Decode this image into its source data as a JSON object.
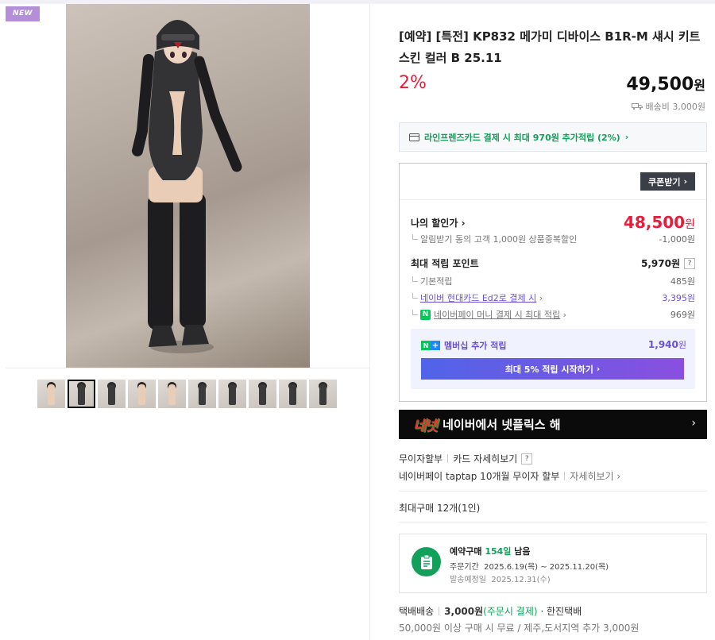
{
  "badge": "NEW",
  "product": {
    "title": "[예약] [특전] KP832 메가미 디바이스 B1R-M 섀시 키트 스킨 컬러 B 25.11",
    "discount_rate": "2%",
    "price": "49,500",
    "price_unit": "원",
    "shipping_fee": "배송비 3,000원"
  },
  "card_banner": "라인프렌즈카드 결제 시 최대 970원 추가적립 (2%)",
  "benefits": {
    "coupon_button": "쿠폰받기",
    "my_price_label": "나의 할인가",
    "my_price": "48,500",
    "my_price_unit": "원",
    "sub_discount_label": "알림받기 동의 고객 1,000원 상품중복할인",
    "sub_discount_value": "-1,000원",
    "points_label": "최대 적립 포인트",
    "points_value": "5,970원",
    "help_mark": "?",
    "points_items": [
      {
        "label": "기본적립",
        "value": "485원"
      },
      {
        "label": "네이버 현대카드 Ed2로 결제 시",
        "value": "3,395원"
      },
      {
        "label": "네이버페이 머니 결제 시 최대 적립",
        "value": "969원"
      }
    ],
    "membership_label": "멤버십 추가 적립",
    "membership_value": "1,940",
    "membership_unit": "원",
    "membership_cta": "최대 5% 적립 시작하기"
  },
  "netflix_banner": {
    "logo_text": "네넷",
    "text": "네이버에서 넷플릭스 해"
  },
  "installment": {
    "no_interest": "무이자할부",
    "card_detail": "카드 자세히보기",
    "npay_taptap": "네이버페이 taptap 10개월 무이자 할부",
    "detail_link": "자세히보기"
  },
  "max_purchase": "최대구매 12개(1인)",
  "preorder": {
    "title_prefix": "예약구매",
    "days": "154일",
    "title_suffix": "남음",
    "order_period_label": "주문기간",
    "order_period": "2025.6.19(목) ~ 2025.11.20(목)",
    "ship_date_label": "발송예정일",
    "ship_date": "2025.12.31(수)"
  },
  "delivery": {
    "method": "택배배송",
    "fee": "3,000원",
    "fee_note": "(주문시 결제)",
    "carrier": "· 한진택배",
    "condition": "50,000원 이상 구매 시 무료 / 제주,도서지역 추가 3,000원"
  },
  "colors": {
    "accent_red": "#e61e3c",
    "naver_green": "#13a05a",
    "purple": "#6b4fd8"
  }
}
